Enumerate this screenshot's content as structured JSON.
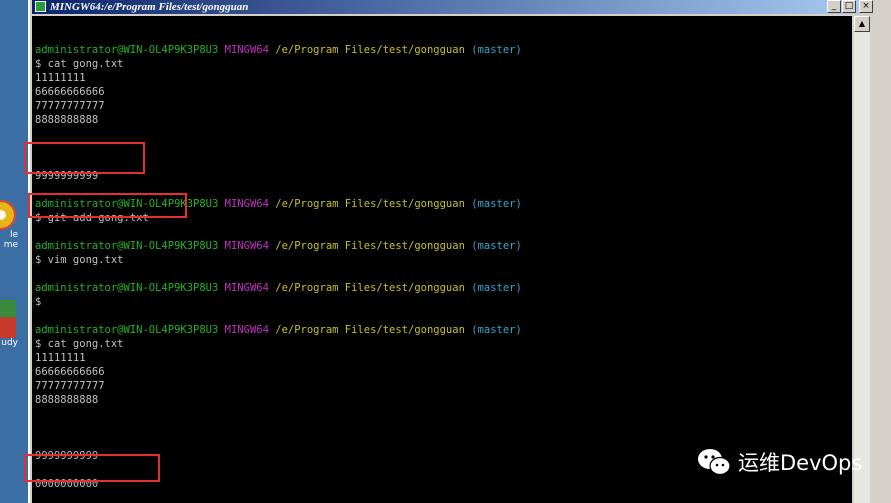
{
  "window": {
    "title": "MINGW64:/e/Program Files/test/gongguan",
    "minimize_glyph": "_",
    "maximize_glyph": "□",
    "close_glyph": "×"
  },
  "desktop_icons": [
    {
      "caption_line1": "le",
      "caption_line2": "me",
      "icon": "browser-icon"
    },
    {
      "caption_line1": "udy",
      "icon": "studio-icon"
    }
  ],
  "prompt": {
    "user": "administrator@WIN-OL4P9K3P8U3",
    "system": "MINGW64",
    "path": "/e/Program Files/test/gongguan",
    "branch": "(master)"
  },
  "terminal_lines": [
    {
      "type": "blank"
    },
    {
      "type": "prompt"
    },
    {
      "type": "text",
      "text": "$ cat gong.txt"
    },
    {
      "type": "text",
      "text": "11111111"
    },
    {
      "type": "text",
      "text": "66666666666"
    },
    {
      "type": "text",
      "text": "77777777777"
    },
    {
      "type": "text",
      "text": "8888888888"
    },
    {
      "type": "blank"
    },
    {
      "type": "blank"
    },
    {
      "type": "blank"
    },
    {
      "type": "text",
      "text": "9999999999"
    },
    {
      "type": "blank"
    },
    {
      "type": "prompt"
    },
    {
      "type": "text",
      "text": "$ git add gong.txt"
    },
    {
      "type": "blank"
    },
    {
      "type": "prompt"
    },
    {
      "type": "text",
      "text": "$ vim gong.txt"
    },
    {
      "type": "blank"
    },
    {
      "type": "prompt"
    },
    {
      "type": "text",
      "text": "$"
    },
    {
      "type": "blank"
    },
    {
      "type": "prompt"
    },
    {
      "type": "text",
      "text": "$ cat gong.txt"
    },
    {
      "type": "text",
      "text": "11111111"
    },
    {
      "type": "text",
      "text": "66666666666"
    },
    {
      "type": "text",
      "text": "77777777777"
    },
    {
      "type": "text",
      "text": "8888888888"
    },
    {
      "type": "blank"
    },
    {
      "type": "blank"
    },
    {
      "type": "blank"
    },
    {
      "type": "text",
      "text": "9999999999"
    },
    {
      "type": "blank"
    },
    {
      "type": "text",
      "text": "0000000000"
    },
    {
      "type": "blank"
    },
    {
      "type": "prompt"
    }
  ],
  "watermark": {
    "text": "运维DevOps",
    "icon": "wechat-icon"
  },
  "colors": {
    "terminal_bg": "#000000",
    "text": "#c0c0c0",
    "user": "#23b323",
    "system": "#c030c0",
    "path": "#c8c020",
    "branch": "#2aa9c9",
    "highlight": "#e03030",
    "titlebar": "#0a246a"
  }
}
